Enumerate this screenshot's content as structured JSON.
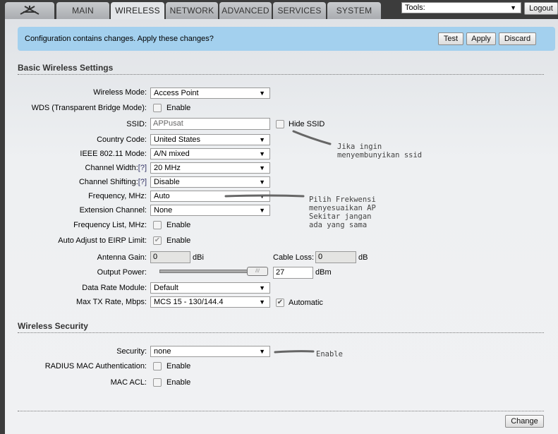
{
  "nav": {
    "tabs": [
      "MAIN",
      "WIRELESS",
      "NETWORK",
      "ADVANCED",
      "SERVICES",
      "SYSTEM"
    ],
    "active": "WIRELESS",
    "tools": "Tools:",
    "logout": "Logout"
  },
  "banner": {
    "message": "Configuration contains changes. Apply these changes?",
    "test": "Test",
    "apply": "Apply",
    "discard": "Discard"
  },
  "basic": {
    "title": "Basic Wireless Settings",
    "wireless_mode": {
      "label": "Wireless Mode:",
      "value": "Access Point"
    },
    "wds": {
      "label": "WDS (Transparent Bridge Mode):",
      "option": "Enable",
      "checked": false
    },
    "ssid": {
      "label": "SSID:",
      "value": "APPusat",
      "hide": "Hide SSID",
      "hide_checked": false
    },
    "country": {
      "label": "Country Code:",
      "value": "United States"
    },
    "ieee": {
      "label": "IEEE 802.11 Mode:",
      "value": "A/N mixed"
    },
    "channel_width": {
      "label": "Channel Width:",
      "help": "[?]",
      "value": "20 MHz"
    },
    "channel_shifting": {
      "label": "Channel Shifting:",
      "help": "[?]",
      "value": "Disable"
    },
    "frequency": {
      "label": "Frequency, MHz:",
      "value": "Auto"
    },
    "extension": {
      "label": "Extension Channel:",
      "value": "None"
    },
    "freq_list": {
      "label": "Frequency List, MHz:",
      "option": "Enable",
      "checked": false
    },
    "eirp": {
      "label": "Auto Adjust to EIRP Limit:",
      "option": "Enable",
      "checked": true
    },
    "antenna_gain": {
      "label": "Antenna Gain:",
      "value": "0",
      "unit": "dBi"
    },
    "cable_loss": {
      "label": "Cable Loss:",
      "value": "0",
      "unit": "dB"
    },
    "output_power": {
      "label": "Output Power:",
      "value": "27",
      "unit": "dBm",
      "slider_fraction": 1.0
    },
    "data_rate": {
      "label": "Data Rate Module:",
      "value": "Default"
    },
    "max_tx": {
      "label": "Max TX Rate, Mbps:",
      "value": "MCS 15 - 130/144.4",
      "auto": "Automatic",
      "auto_checked": true
    }
  },
  "security": {
    "title": "Wireless Security",
    "security": {
      "label": "Security:",
      "value": "none"
    },
    "radius": {
      "label": "RADIUS MAC Authentication:",
      "option": "Enable"
    },
    "mac_acl": {
      "label": "MAC ACL:",
      "option": "Enable"
    }
  },
  "annotations": {
    "ssid": "Jika ingin\nmenyembunyikan ssid",
    "frequency": "Pilih Frekwensi\nmenyesuaikan AP\nSekitar jangan\nada yang sama",
    "security": "Enable"
  },
  "footer": {
    "change": "Change"
  },
  "colors": {
    "banner": "#a3d0ee",
    "topbar": "#3c3c3c"
  }
}
